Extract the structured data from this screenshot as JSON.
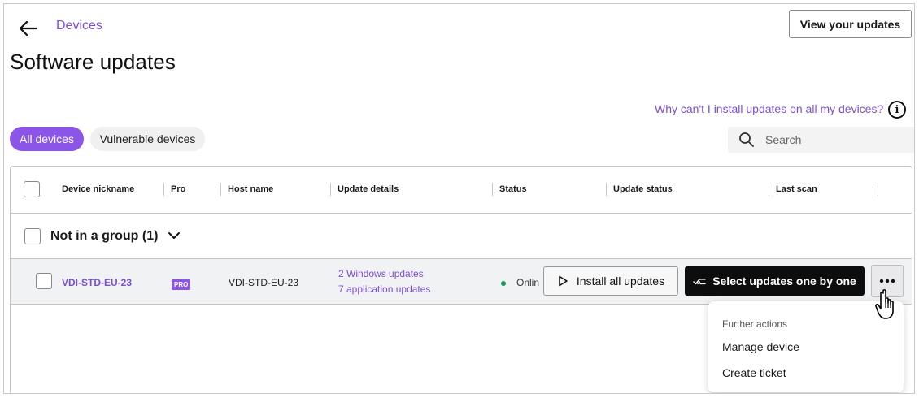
{
  "breadcrumb": {
    "back_icon": "arrow-left-icon",
    "parent": "Devices"
  },
  "page": {
    "title": "Software updates"
  },
  "header": {
    "view_updates_label": "View your updates"
  },
  "help": {
    "link": "Why can't I install updates on all my devices?",
    "icon": "info-icon"
  },
  "filters": [
    {
      "label": "All devices",
      "active": true
    },
    {
      "label": "Vulnerable devices",
      "active": false
    }
  ],
  "search": {
    "placeholder": "Search",
    "value": "",
    "icon": "search-icon"
  },
  "table": {
    "columns": [
      "Device nickname",
      "Pro",
      "Host name",
      "Update details",
      "Status",
      "Update status",
      "Last scan"
    ],
    "group": {
      "label": "Not in a group",
      "count": "(1)"
    },
    "rows": [
      {
        "nickname": "VDI-STD-EU-23",
        "pro_badge": "PRO",
        "host": "VDI-STD-EU-23",
        "windows_updates": "2 Windows updates",
        "app_updates": "7 application updates",
        "status": "Online",
        "install_label": "Install all updates",
        "select_label": "Select updates one by one"
      }
    ]
  },
  "menu": {
    "header": "Further actions",
    "items": [
      "Manage device",
      "Create ticket"
    ]
  },
  "colors": {
    "accent": "#8b55e8",
    "link": "#7a4fd6",
    "online": "#1a9b5a"
  }
}
